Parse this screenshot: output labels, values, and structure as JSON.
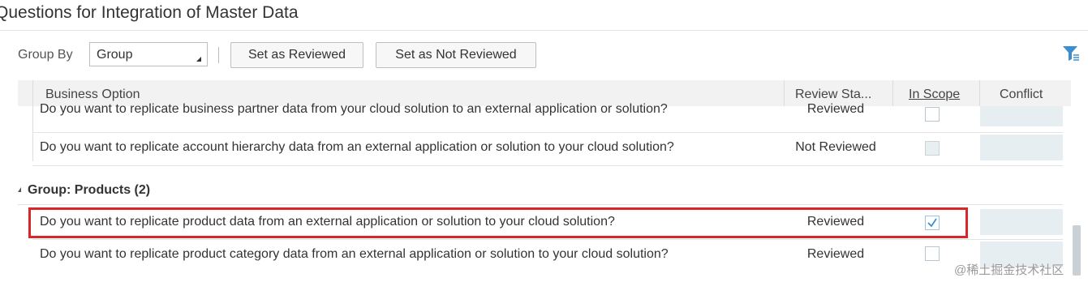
{
  "title": "Questions for Integration of  Master Data",
  "toolbar": {
    "group_by_label": "Group By",
    "group_by_value": "Group",
    "set_reviewed": "Set as Reviewed",
    "set_not_reviewed": "Set as Not Reviewed",
    "filter_icon": "filter-icon"
  },
  "table": {
    "columns": {
      "business_option": "Business Option",
      "review_status": "Review Sta...",
      "in_scope": "In Scope",
      "conflict": "Conflict"
    },
    "rows_top": [
      {
        "question": "Do you want to replicate business partner data from your cloud solution to an external application or solution?",
        "status": "Reviewed",
        "in_scope": false
      },
      {
        "question": "Do you want to replicate account hierarchy data from an external application or solution to your cloud solution?",
        "status": "Not Reviewed",
        "in_scope": false
      }
    ],
    "group": {
      "label": "Group: Products (2)",
      "rows": [
        {
          "question": "Do you want to replicate product data from an external application or solution to your cloud solution?",
          "status": "Reviewed",
          "in_scope": true
        },
        {
          "question": "Do you want to replicate product category data from an external application or solution to your cloud solution?",
          "status": "Reviewed",
          "in_scope": false
        }
      ]
    }
  },
  "highlight_color": "#d9262a",
  "watermark": "@稀土掘金技术社区"
}
